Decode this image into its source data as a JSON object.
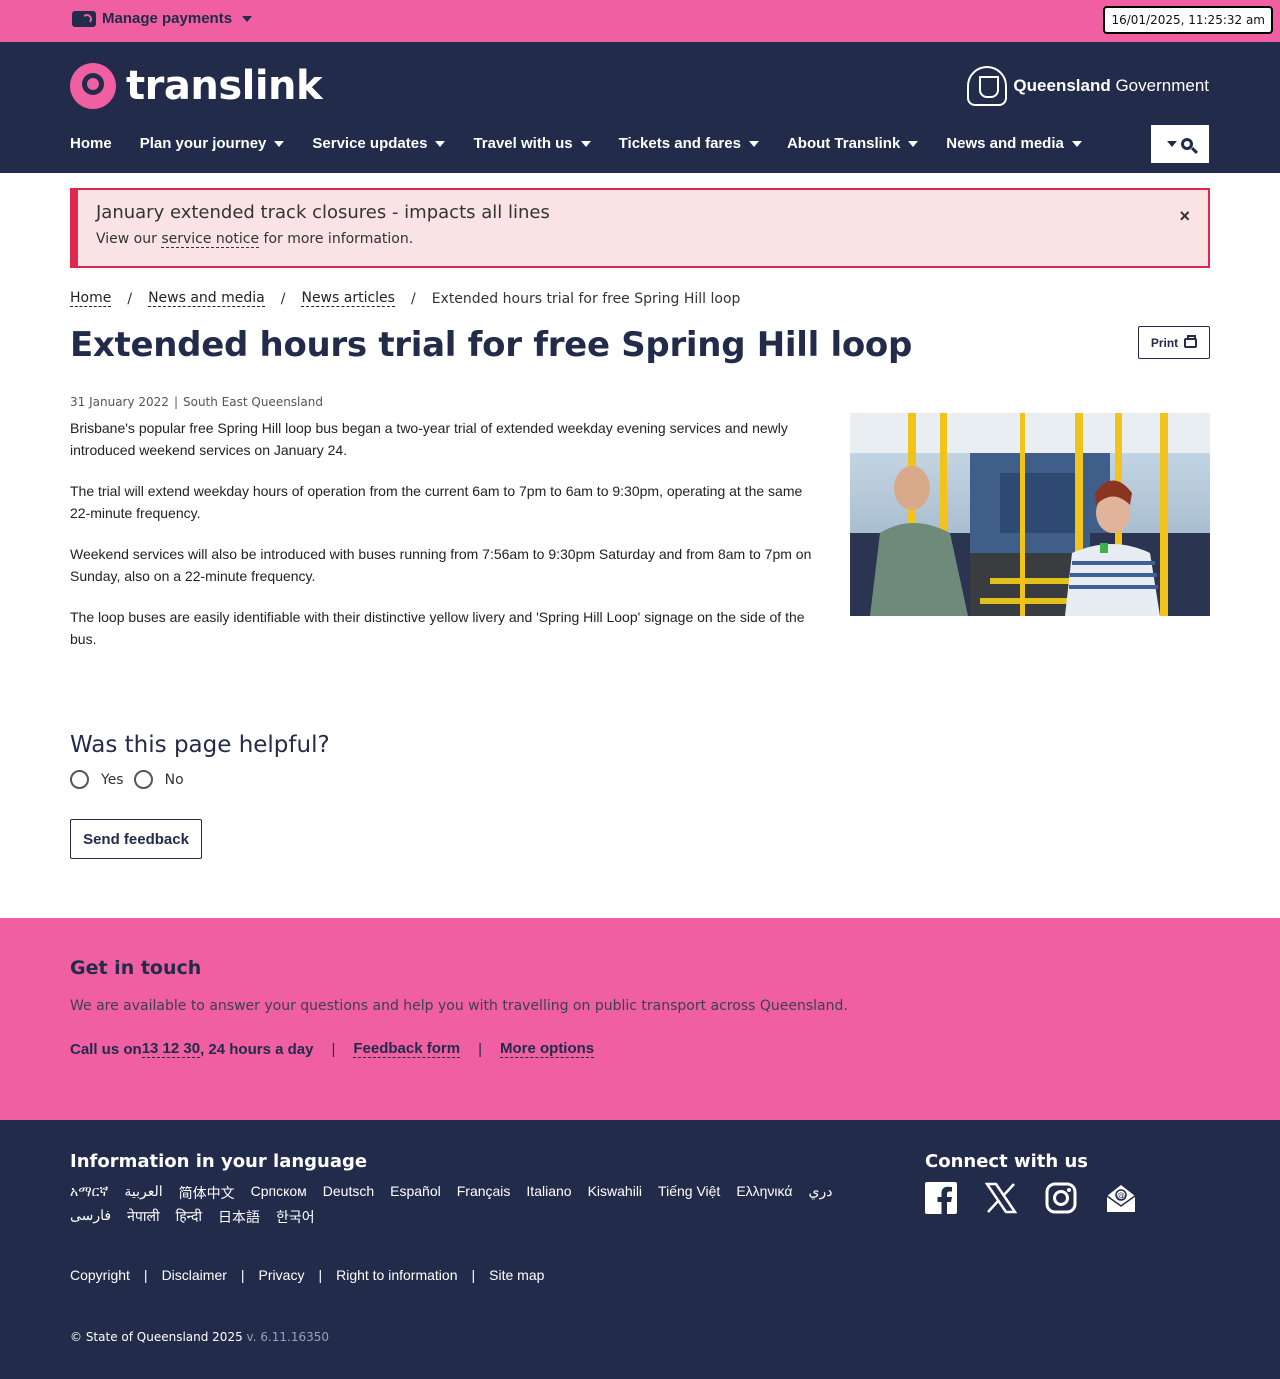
{
  "topbar": {
    "manage_payments": "Manage payments",
    "datetime": "16/01/2025, 11:25:32 am"
  },
  "header": {
    "logo_text": "translink",
    "gov_bold": "Queensland",
    "gov_rest": " Government",
    "nav": [
      {
        "label": "Home",
        "dropdown": false
      },
      {
        "label": "Plan your journey",
        "dropdown": true
      },
      {
        "label": "Service updates",
        "dropdown": true
      },
      {
        "label": "Travel with us",
        "dropdown": true
      },
      {
        "label": "Tickets and fares",
        "dropdown": true
      },
      {
        "label": "About Translink",
        "dropdown": true
      },
      {
        "label": "News and media",
        "dropdown": true
      }
    ]
  },
  "alert": {
    "title": "January extended track closures - impacts all lines",
    "body_prefix": "View our ",
    "link": "service notice",
    "body_suffix": " for more information.",
    "close": "×"
  },
  "breadcrumb": {
    "items": [
      "Home",
      "News and media",
      "News articles"
    ],
    "current": "Extended hours trial for free Spring Hill loop",
    "sep": "/"
  },
  "article": {
    "title": "Extended hours trial for free Spring Hill loop",
    "print_label": "Print",
    "date": "31 January 2022",
    "region": "South East Queensland",
    "paragraphs": [
      "Brisbane's popular free Spring Hill loop bus began a two-year trial of extended weekday evening services and newly introduced weekend services on January 24.",
      "The trial will extend weekday hours of operation from the current 6am to 7pm to 6am to 9:30pm, operating at the same 22-minute frequency.",
      "Weekend services will also be introduced with buses running from 7:56am to 9:30pm Saturday and from 8am to 7pm on Sunday, also on a 22-minute frequency.",
      "The loop buses are easily identifiable with their distinctive yellow livery and 'Spring Hill Loop' signage on the side of the bus."
    ]
  },
  "feedback": {
    "title": "Was this page helpful?",
    "yes": "Yes",
    "no": "No",
    "send": "Send feedback"
  },
  "touch": {
    "title": "Get in touch",
    "desc": "We are available to answer your questions and help you with travelling on public transport across Queensland.",
    "call_prefix": "Call us on ",
    "phone": "13 12 30",
    "call_suffix": ", 24 hours a day",
    "feedback_form": "Feedback form",
    "more_options": "More options",
    "sep": "|"
  },
  "footer": {
    "lang_title": "Information in your language",
    "languages": [
      "አማርኛ",
      "العربية",
      "简体中文",
      "Српском",
      "Deutsch",
      "Español",
      "Français",
      "Italiano",
      "Kiswahili",
      "Tiếng Việt",
      "Ελληνικά",
      "دري",
      "فارسی",
      "नेपाली",
      "हिन्दी",
      "日本語",
      "한국어"
    ],
    "connect_title": "Connect with us",
    "social": [
      "facebook-icon",
      "x-icon",
      "instagram-icon",
      "email-icon"
    ],
    "links": [
      "Copyright",
      "Disclaimer",
      "Privacy",
      "Right to information",
      "Site map"
    ],
    "copyright": "© State of Queensland 2025",
    "version": " v. 6.11.16350"
  },
  "colors": {
    "brand_pink": "#ef5fa2",
    "navy": "#222b4a",
    "alert_red": "#e0284f",
    "alert_bg": "#f9e3e4"
  }
}
